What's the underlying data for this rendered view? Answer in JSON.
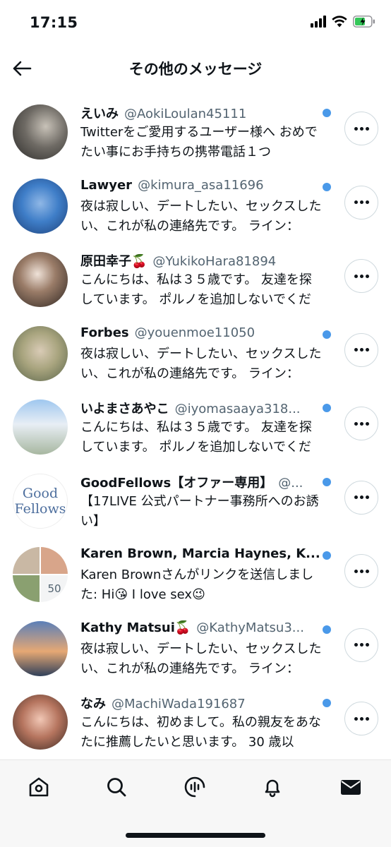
{
  "status_bar": {
    "time": "17:15"
  },
  "header": {
    "title": "その他のメッセージ"
  },
  "messages": [
    {
      "name": "えいみ",
      "handle": "@AokiLoulan45111",
      "text": "Twitterをご愛用するユーザー様へ おめでたい事にお手持ちの携帯電話１つ",
      "unread": true
    },
    {
      "name": "Lawyer",
      "handle": "@kimura_asa11696",
      "text": "夜は寂しい、デートしたい、セックスしたい、これが私の連絡先です。 ライン：",
      "unread": true
    },
    {
      "name": "原田幸子🍒",
      "handle": "@YukikoHara81894",
      "text": "こんにちは、私は３５歳です。 友達を探しています。 ポルノを追加しないでくだ",
      "unread": true
    },
    {
      "name": "Forbes",
      "handle": "@youenmoe11050",
      "text": "夜は寂しい、デートしたい、セックスしたい、これが私の連絡先です。 ライン：",
      "unread": true
    },
    {
      "name": "いよまさあやこ",
      "handle": "@iyomasaaya318...",
      "text": "こんにちは、私は３５歳です。 友達を探しています。 ポルノを追加しないでくだ",
      "unread": true
    },
    {
      "name": "GoodFellows【オファー専用】",
      "handle": "@...",
      "text": "【17LIVE 公式パートナー事務所へのお誘い】",
      "unread": true,
      "avatar_text_1": "Good",
      "avatar_text_2": "Fellows"
    },
    {
      "name": "Karen Brown, Marcia Haynes, K...",
      "handle": "",
      "text": "Karen Brownさんがリンクを送信しました: Hi😘 I love sex😉",
      "unread": true,
      "group_count": "50"
    },
    {
      "name": "Kathy Matsui🍒",
      "handle": "@KathyMatsu3...",
      "text": "夜は寂しい、デートしたい、セックスしたい、これが私の連絡先です。 ライン：",
      "unread": true
    },
    {
      "name": "なみ",
      "handle": "@MachiWada191687",
      "text": "こんにちは、初めまして。私の親友をあなたに推薦したいと思います。 30 歳以",
      "unread": true
    }
  ],
  "nav": {
    "items": [
      "home-icon",
      "search-icon",
      "spaces-icon",
      "notifications-icon",
      "messages-icon"
    ]
  },
  "colors": {
    "unread_dot": "#4a99e9",
    "text_primary": "#0f1419",
    "text_secondary": "#536471"
  }
}
